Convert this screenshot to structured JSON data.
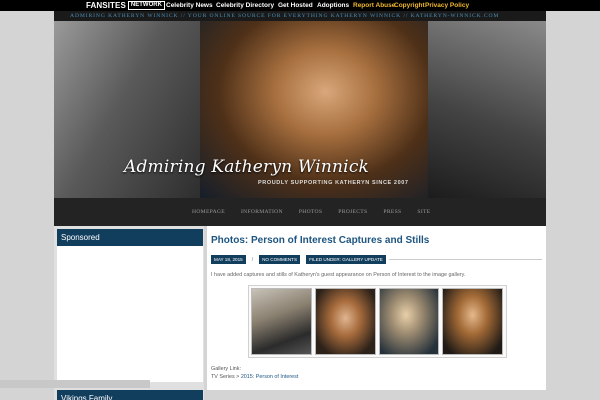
{
  "network": {
    "brand": "FANSITES",
    "badge": "NETWORK",
    "links": [
      {
        "label": "Celebrity News",
        "color": "#ffffff"
      },
      {
        "label": "Celebrity Directory",
        "color": "#ffffff"
      },
      {
        "label": "Get Hosted",
        "color": "#ffffff"
      },
      {
        "label": "Adoptions",
        "color": "#ffffff"
      },
      {
        "label": "Report Abuse",
        "color": "#f2b830"
      },
      {
        "label": "Copyright",
        "color": "#f2b830"
      },
      {
        "label": "Privacy Policy",
        "color": "#f2b830"
      }
    ]
  },
  "tagline": "ADMIRING KATHERYN WINNICK  //  YOUR ONLINE SOURCE FOR EVERYTHING KATHERYN WINNICK  //  KATHERYN-WINNICK.COM",
  "header": {
    "title": "Admiring Katheryn Winnick",
    "subtitle": "PROUDLY SUPPORTING KATHERYN SINCE 2007"
  },
  "nav": [
    "HOMEPAGE",
    "INFORMATION",
    "PHOTOS",
    "PROJECTS",
    "PRESS",
    "SITE"
  ],
  "sidebar": {
    "widgets": [
      {
        "title": "Sponsored"
      },
      {
        "title": "Vikings Family"
      }
    ]
  },
  "post": {
    "title": "Photos: Person of Interest Captures and Stills",
    "date": "MAY 18, 2015",
    "separator": "/",
    "comments": "NO COMMENTS",
    "filed": "FILED UNDER: GALLERY UPDATE",
    "text": "I have added captures and stills of Katheryn's guest appearance on Person of Interest to the image gallery.",
    "gallery_label": "Gallery Link:",
    "gallery_path_prefix": "TV Series > ",
    "gallery_link": "2015: Person of Interest"
  },
  "colors": {
    "accent": "#123e5e",
    "link": "#1e5580",
    "network_highlight": "#f2b830"
  }
}
